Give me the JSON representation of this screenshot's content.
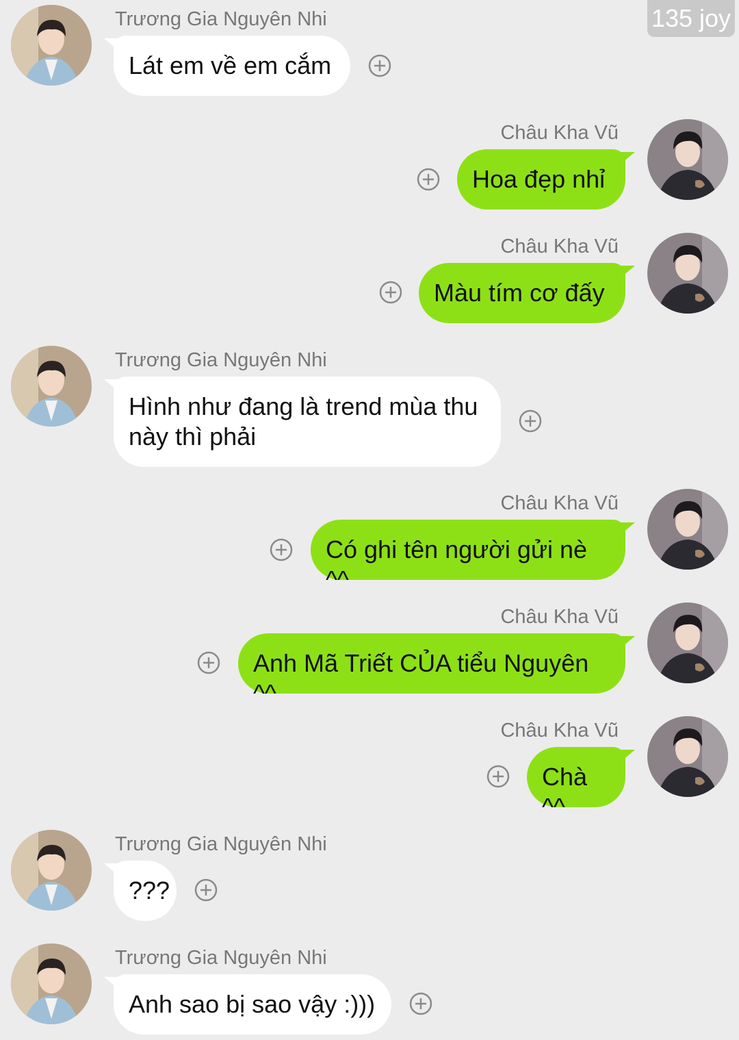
{
  "badge": "135 joy",
  "contacts": {
    "left_name": "Trương Gia Nguyên Nhi",
    "right_name": "Châu Kha Vũ"
  },
  "messages": [
    {
      "side": "left",
      "name": "Trương Gia Nguyên Nhi",
      "text": "Lát em về em cắm"
    },
    {
      "side": "right",
      "name": "Châu Kha Vũ",
      "text": "Hoa đẹp nhỉ"
    },
    {
      "side": "right",
      "name": "Châu Kha Vũ",
      "text": "Màu tím cơ đấy"
    },
    {
      "side": "left",
      "name": "Trương Gia Nguyên Nhi",
      "text": "Hình như đang là trend mùa thu\nnày thì phải"
    },
    {
      "side": "right",
      "name": "Châu Kha Vũ",
      "text": "Có ghi tên người gửi nè ^^"
    },
    {
      "side": "right",
      "name": "Châu Kha Vũ",
      "text": "Anh Mã Triết CỦA tiểu Nguyên ^^"
    },
    {
      "side": "right",
      "name": "Châu Kha Vũ",
      "text": "Chà ^^"
    },
    {
      "side": "left",
      "name": "Trương Gia Nguyên Nhi",
      "text": "???"
    },
    {
      "side": "left",
      "name": "Trương Gia Nguyên Nhi",
      "text": "Anh sao bị sao vậy :)))"
    }
  ],
  "icons": {
    "add": "plus-circle-icon",
    "left_avatar": "avatar-light-blue-suit",
    "right_avatar": "avatar-dark-outfit"
  },
  "colors": {
    "background": "#ececec",
    "incoming_bubble": "#ffffff",
    "outgoing_bubble": "#8ee016",
    "name_text": "#777777",
    "badge_bg": "#c9c9c9"
  }
}
